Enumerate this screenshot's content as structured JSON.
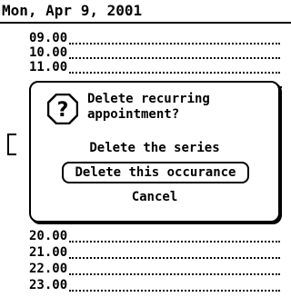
{
  "header": {
    "date": "Mon, Apr 9, 2001"
  },
  "schedule": {
    "slots": [
      "09.00",
      "10.00",
      "11.00",
      "20.00",
      "21.00",
      "22.00",
      "23.00"
    ]
  },
  "dialog": {
    "icon": "question-icon",
    "prompt_line1": "Delete recurring",
    "prompt_line2": "appointment?",
    "option_series": "Delete the series",
    "option_occurrence": "Delete this occurance",
    "option_cancel": "Cancel"
  }
}
